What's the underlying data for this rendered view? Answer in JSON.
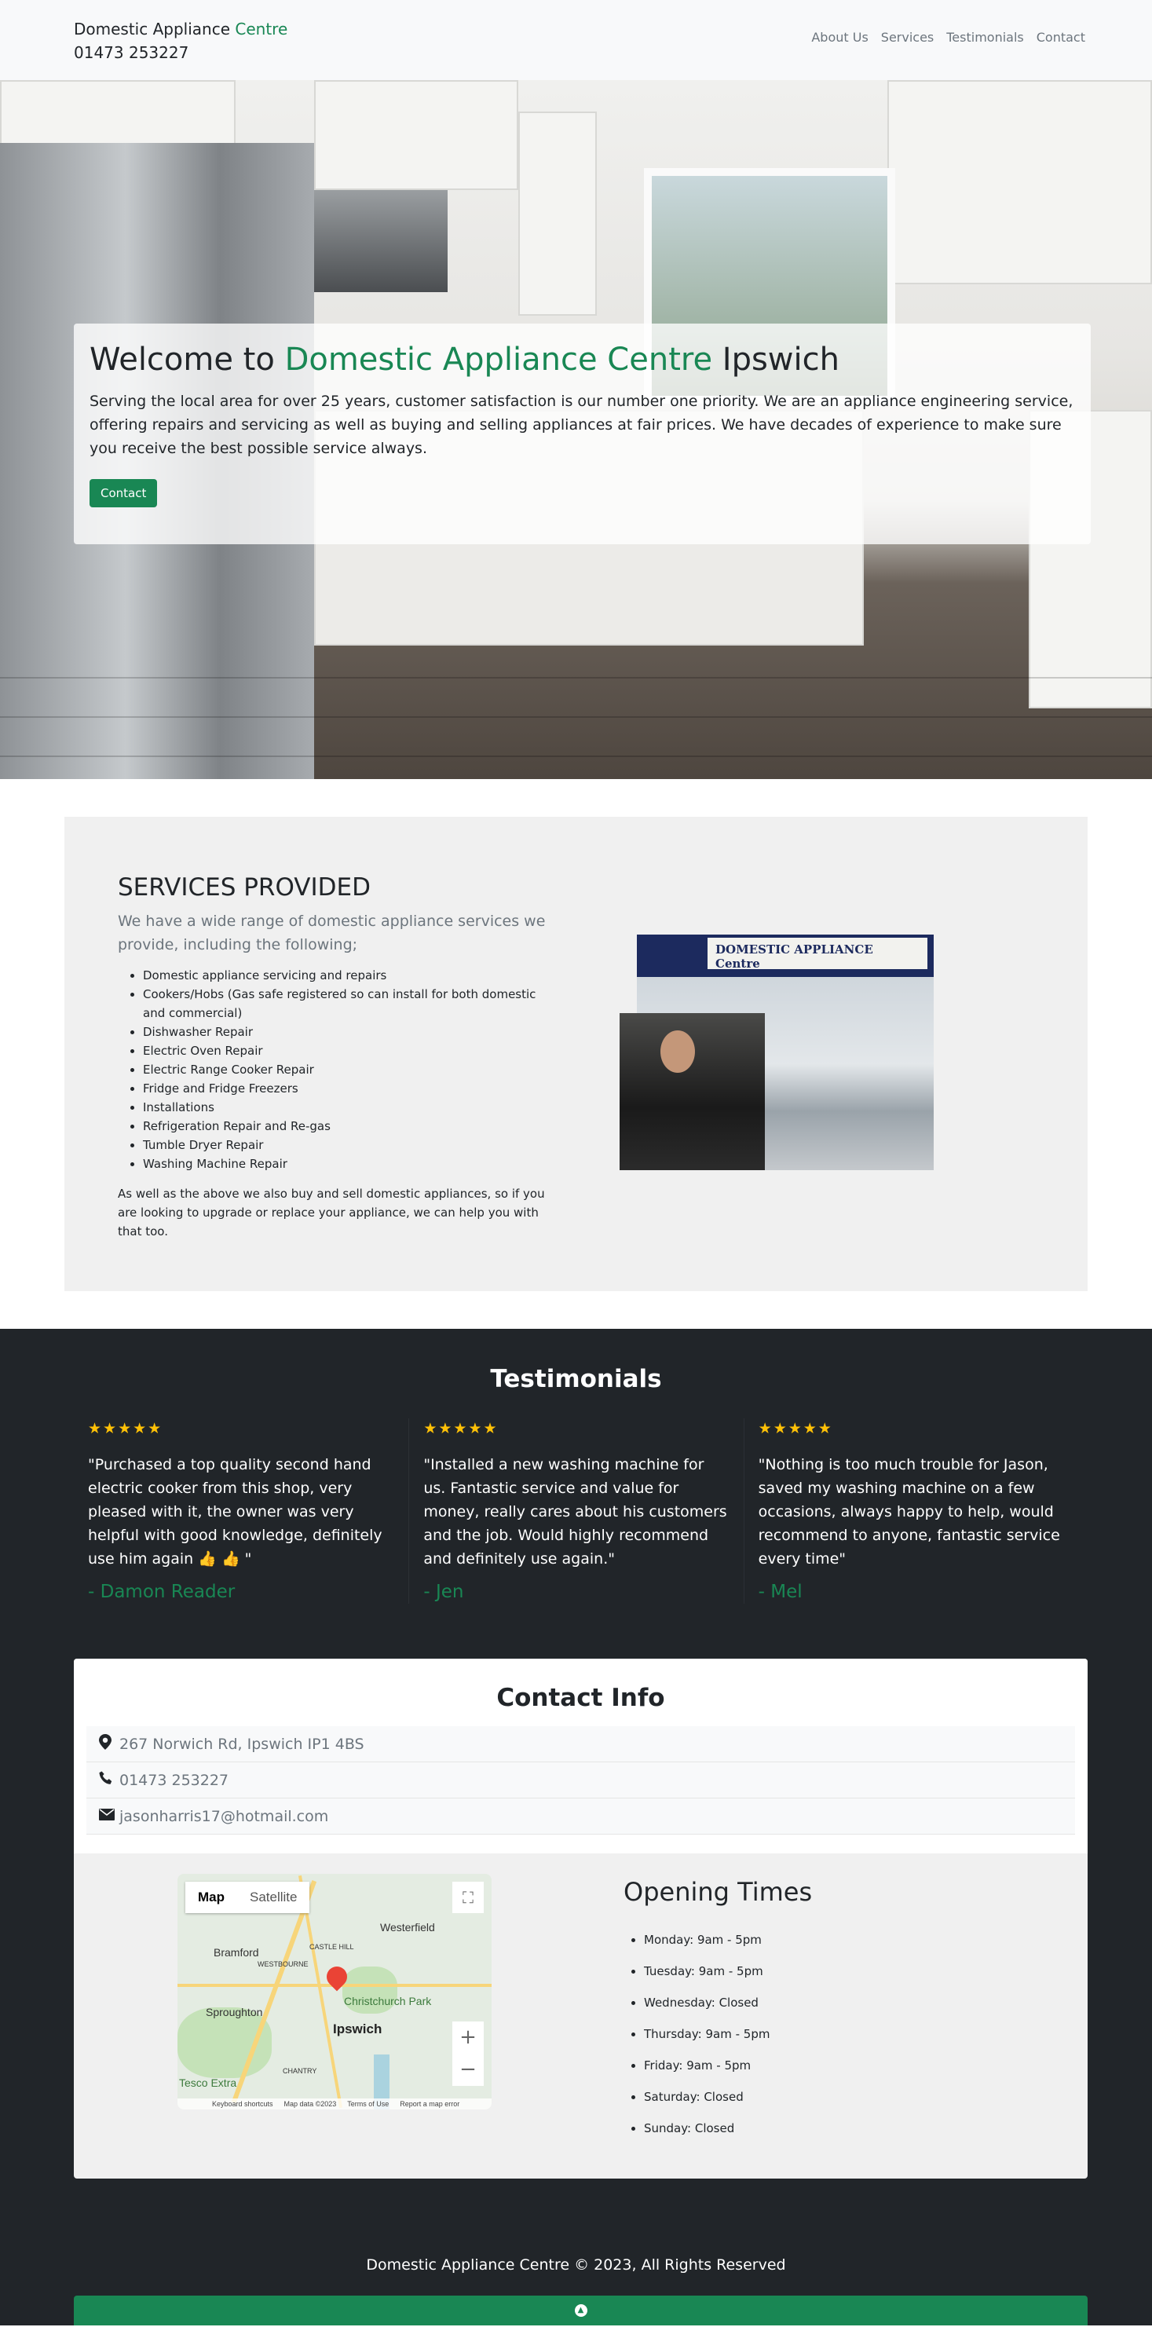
{
  "nav": {
    "brand_main": "Domestic Appliance ",
    "brand_accent": "Centre",
    "phone": "01473 253227",
    "links": [
      "About Us",
      "Services",
      "Testimonials",
      "Contact"
    ]
  },
  "hero": {
    "title_prefix": "Welcome to ",
    "title_accent": "Domestic Appliance Centre",
    "title_suffix": " Ipswich",
    "text": "Serving the local area for over 25 years, customer satisfaction is our number one priority. We are an appliance engineering service, offering repairs and servicing as well as buying and selling appliances at fair prices. We have decades of experience to make sure you receive the best possible service always.",
    "button": "Contact"
  },
  "services": {
    "title": "SERVICES PROVIDED",
    "lead": "We have a wide range of domestic appliance services we provide, including the following;",
    "items": [
      "Domestic appliance servicing and repairs",
      "Cookers/Hobs (Gas safe registered so can install for both domestic and commercial)",
      "Dishwasher Repair",
      "Electric Oven Repair",
      "Electric Range Cooker Repair",
      "Fridge and Fridge Freezers",
      "Installations",
      "Refrigeration Repair and Re-gas",
      "Tumble Dryer Repair",
      "Washing Machine Repair"
    ],
    "footer": "As well as the above we also buy and sell domestic appliances, so if you are looking to upgrade or replace your appliance, we can help you with that too.",
    "shop_sign": "DOMESTIC APPLIANCE Centre"
  },
  "testimonials": {
    "title": "Testimonials",
    "stars": "★★★★★",
    "items": [
      {
        "quote": "\"Purchased a top quality second hand electric cooker from this shop, very pleased with it, the owner was very helpful with good knowledge, definitely use him again 👍 👍 \"",
        "author": "- Damon Reader"
      },
      {
        "quote": "\"Installed a new washing machine for us. Fantastic service and value for money, really cares about his customers and the job. Would highly recommend and definitely use again.\"",
        "author": "- Jen"
      },
      {
        "quote": "\"Nothing is too much trouble for Jason, saved my washing machine on a few occasions, always happy to help, would recommend to anyone, fantastic service every time\"",
        "author": "- Mel"
      }
    ]
  },
  "contact": {
    "title": "Contact Info",
    "address": "267 Norwich Rd, Ipswich IP1 4BS",
    "phone": "01473 253227",
    "email": "jasonharris17@hotmail.com"
  },
  "map": {
    "tab_map": "Map",
    "tab_satellite": "Satellite",
    "labels": [
      "Westerfield",
      "Bramford",
      "Sproughton",
      "Ipswich",
      "Christchurch Park",
      "Tesco Extra",
      "CASTLE HILL",
      "WESTBOURNE",
      "CHANTRY"
    ],
    "footer": [
      "Keyboard shortcuts",
      "Map data ©2023",
      "Terms of Use",
      "Report a map error"
    ]
  },
  "opening": {
    "title": "Opening Times",
    "days": [
      "Monday: 9am - 5pm",
      "Tuesday: 9am - 5pm",
      "Wednesday: Closed",
      "Thursday: 9am - 5pm",
      "Friday: 9am - 5pm",
      "Saturday: Closed",
      "Sunday: Closed"
    ]
  },
  "footer": {
    "text": "Domestic Appliance Centre © 2023, All Rights Reserved"
  },
  "colors": {
    "accent": "#198754",
    "dark": "#212529",
    "star": "#ffc107"
  }
}
